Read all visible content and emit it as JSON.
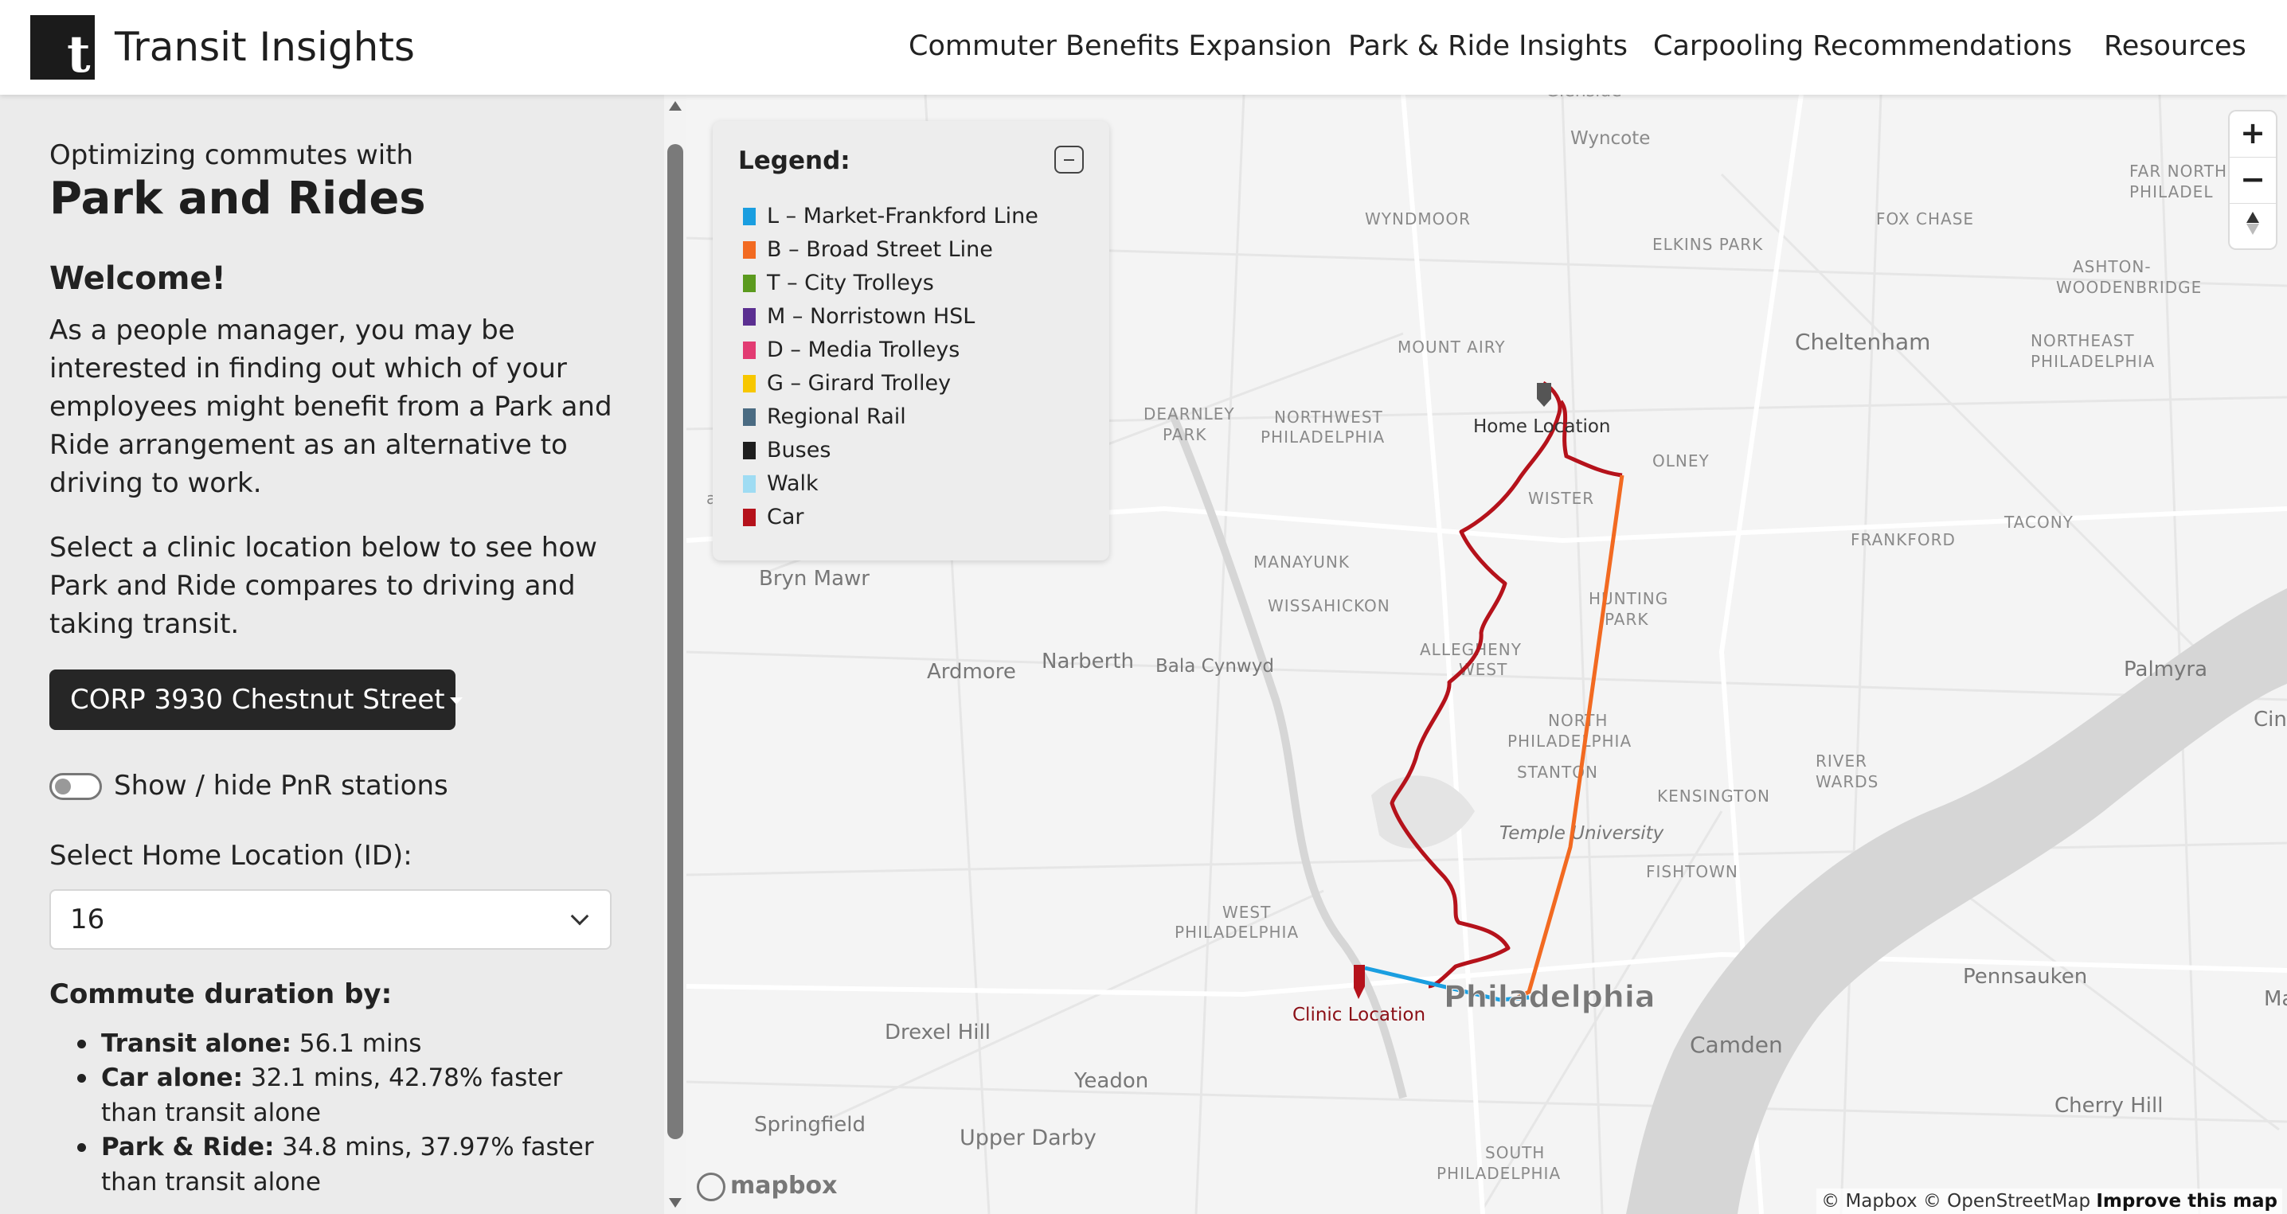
{
  "header": {
    "logo_letter": "t",
    "brand": "Transit Insights",
    "nav": [
      {
        "label": "Commuter Benefits Expansion"
      },
      {
        "label": "Park & Ride Insights"
      },
      {
        "label": "Carpooling Recommendations"
      },
      {
        "label": "Resources"
      }
    ]
  },
  "sidebar": {
    "subtitle": "Optimizing commutes with",
    "title": "Park and Rides",
    "welcome": "Welcome!",
    "intro": "As a people manager, you may be interested in finding out which of your employees might benefit from a Park and Ride arrangement as an alternative to driving to work.",
    "instructions": "Select a clinic location below to see how Park and Ride compares to driving and taking transit.",
    "clinic_dropdown": "CORP 3930 Chestnut Street",
    "toggle_label": "Show / hide PnR stations",
    "toggle_on": false,
    "home_select_label": "Select Home Location (ID):",
    "home_select_value": "16",
    "duration_title": "Commute duration by:",
    "durations": [
      {
        "label": "Transit alone:",
        "text": " 56.1 mins"
      },
      {
        "label": "Car alone:",
        "text": " 32.1 mins, 42.78% faster than transit alone"
      },
      {
        "label": "Park & Ride:",
        "text": " 34.8 mins, 37.97% faster than transit alone"
      }
    ]
  },
  "legend": {
    "title": "Legend:",
    "items": [
      {
        "label": "L – Market-Frankford Line",
        "color": "#1a9ee0"
      },
      {
        "label": "B – Broad Street Line",
        "color": "#f26a21"
      },
      {
        "label": "T – City Trolleys",
        "color": "#5b9a1e"
      },
      {
        "label": "M – Norristown HSL",
        "color": "#5b2f91"
      },
      {
        "label": "D – Media Trolleys",
        "color": "#e23b72"
      },
      {
        "label": "G – Girard Trolley",
        "color": "#f7c700"
      },
      {
        "label": "Regional Rail",
        "color": "#4a6b82"
      },
      {
        "label": "Buses",
        "color": "#1e1e1e"
      },
      {
        "label": "Walk",
        "color": "#9fdcf3"
      },
      {
        "label": "Car",
        "color": "#b5121b"
      }
    ]
  },
  "map": {
    "home_label": "Home Location",
    "clinic_label": "Clinic Location",
    "city_label": "Philadelphia",
    "place_labels": [
      "Wyncote",
      "WYNDMOOR",
      "ELKINS PARK",
      "FOX CHASE",
      "FAR NORTH",
      "PHILADEL",
      "ASHTON-",
      "WOODENBRIDGE",
      "Cheltenham",
      "NORTHEAST",
      "PHILADELPHIA",
      "MOUNT AIRY",
      "DEARNLEY",
      "PARK",
      "NORTHWEST",
      "PHILADELPHIA",
      "OLNEY",
      "WISTER",
      "TACONY",
      "Bryn Mawr",
      "MANAYUNK",
      "FRANKFORD",
      "WISSAHICKON",
      "HUNTING",
      "PARK",
      "Ardmore",
      "Narberth",
      "Bala Cynwyd",
      "ALLEGHENY",
      "WEST",
      "Palmyra",
      "NORTH",
      "PHILADELPHIA",
      "RIVER",
      "WARDS",
      "STANTON",
      "KENSINGTON",
      "Temple University",
      "FISHTOWN",
      "WEST",
      "PHILADELPHIA",
      "Pennsauken",
      "Drexel Hill",
      "Camden",
      "Yeadon",
      "Cherry Hill",
      "Springfield",
      "Upper Darby",
      "SOUTH",
      "PHILADELPHIA",
      "Glenside",
      "Cin",
      "Ma",
      "a L"
    ],
    "zoom_in": "+",
    "zoom_out": "−",
    "logo_text": "mapbox",
    "attribution_text": "© Mapbox © OpenStreetMap ",
    "attribution_link": "Improve this map"
  }
}
